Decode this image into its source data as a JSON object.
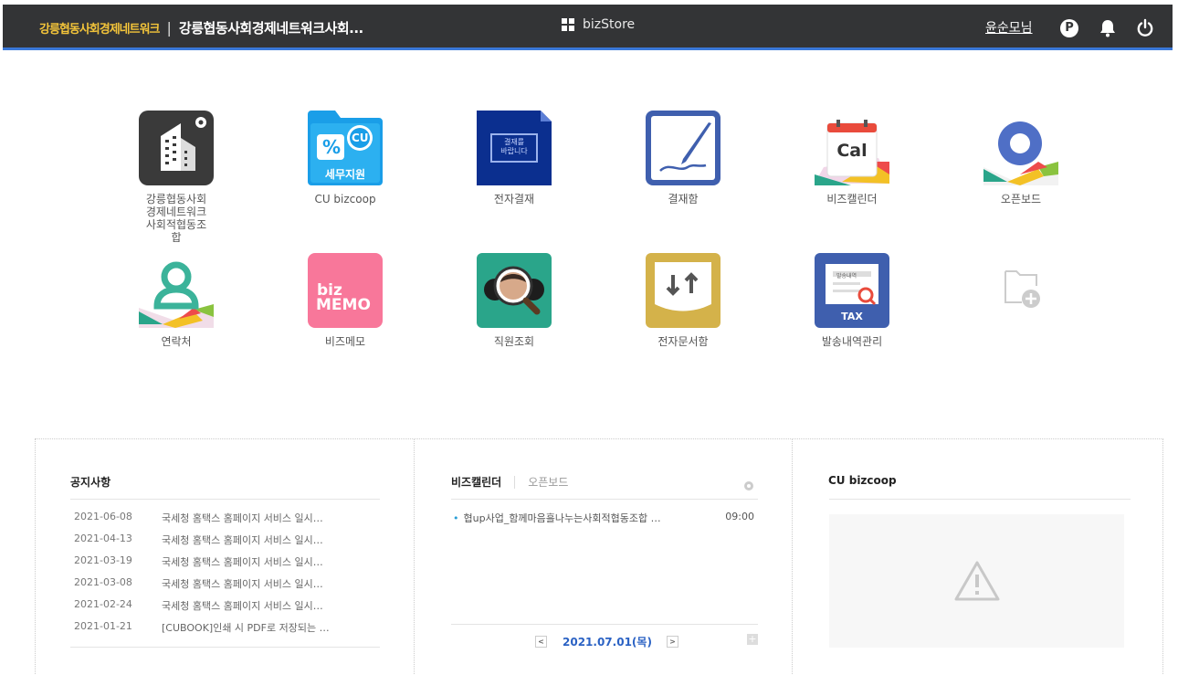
{
  "header": {
    "logo_text": "강릉협동사회경제네트워크",
    "org_name": "강릉협동사회경제네트워크사회...",
    "bizstore_label": "bizStore",
    "user_name": "윤순모님",
    "point_icon": "P",
    "accent_color": "#3a78d8"
  },
  "apps": [
    {
      "label": "강릉협동사회\n경제네트워크\n사회적협동조\n합",
      "icon": "building-icon"
    },
    {
      "label": "CU bizcoop",
      "icon": "tax-folder-icon"
    },
    {
      "label": "전자결재",
      "icon": "approval-icon"
    },
    {
      "label": "결재함",
      "icon": "sign-icon"
    },
    {
      "label": "비즈캘린더",
      "icon": "calendar-icon"
    },
    {
      "label": "오픈보드",
      "icon": "board-icon"
    },
    {
      "label": "연락처",
      "icon": "contact-icon"
    },
    {
      "label": "비즈메모",
      "icon": "memo-icon"
    },
    {
      "label": "직원조회",
      "icon": "employee-search-icon"
    },
    {
      "label": "전자문서함",
      "icon": "document-box-icon"
    },
    {
      "label": "발송내역관리",
      "icon": "tax-history-icon"
    },
    {
      "label": "",
      "icon": "add-app-icon"
    }
  ],
  "icon_text": {
    "cu_badge": "CU",
    "cu_percent": "%",
    "cu_tax": "세무지원",
    "approval_stamp": "결재를\n바랍니다",
    "cal": "Cal",
    "biz": "biz",
    "memo": "MEMO",
    "tax": "TAX",
    "tax_history": "발송내역"
  },
  "notice": {
    "title": "공지사항",
    "rows": [
      {
        "date": "2021-06-08",
        "text": "국세청 홈택스 홈페이지 서비스 일시…"
      },
      {
        "date": "2021-04-13",
        "text": "국세청 홈택스 홈페이지 서비스 일시…"
      },
      {
        "date": "2021-03-19",
        "text": "국세청 홈택스 홈페이지 서비스 일시…"
      },
      {
        "date": "2021-03-08",
        "text": "국세청 홈택스 홈페이지 서비스 일시…"
      },
      {
        "date": "2021-02-24",
        "text": "국세청 홈택스 홈페이지 서비스 일시…"
      },
      {
        "date": "2021-01-21",
        "text": "[CUBOOK]인쇄 시 PDF로 저장되는 …"
      }
    ]
  },
  "calendar": {
    "tab_active": "비즈캘린더",
    "tab_other": "오픈보드",
    "event_title": "협up사업_함께마음흘나누는사회적협동조합 …",
    "event_time": "09:00",
    "date_label": "2021.07.01(목)",
    "prev": "<",
    "next": ">",
    "add": "+"
  },
  "cubizcoop": {
    "title": "CU bizcoop"
  }
}
